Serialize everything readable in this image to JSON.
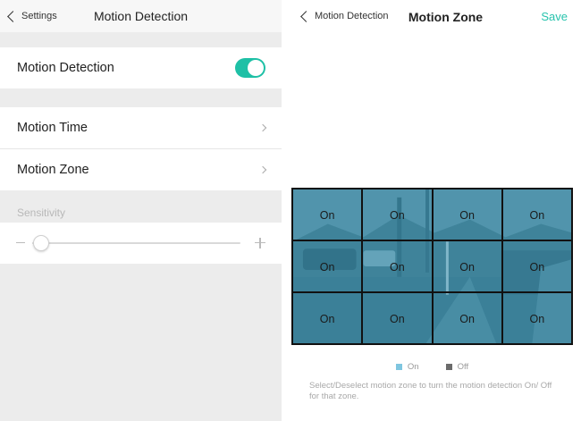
{
  "left": {
    "back_label": "Settings",
    "title": "Motion Detection",
    "toggle_row": {
      "label": "Motion Detection",
      "enabled": true
    },
    "rows": [
      {
        "label": "Motion Time"
      },
      {
        "label": "Motion Zone"
      }
    ],
    "sensitivity": {
      "label": "Sensitivity",
      "value": 0.02,
      "minus_icon": "minus-icon",
      "plus_icon": "plus-icon"
    }
  },
  "right": {
    "back_label": "Motion Detection",
    "title": "Motion Zone",
    "save_label": "Save",
    "zones": [
      "On",
      "On",
      "On",
      "On",
      "On",
      "On",
      "On",
      "On",
      "On",
      "On",
      "On",
      "On"
    ],
    "legend": [
      {
        "label": "On",
        "color": "#7fc6e0"
      },
      {
        "label": "Off",
        "color": "#6b6b6b"
      }
    ],
    "note": "Select/Deselect motion zone to turn the motion detection On/ Off for that zone."
  },
  "colors": {
    "accent": "#1ec0a6",
    "save": "#27c3ad",
    "zone_overlay": "#3991b0"
  }
}
